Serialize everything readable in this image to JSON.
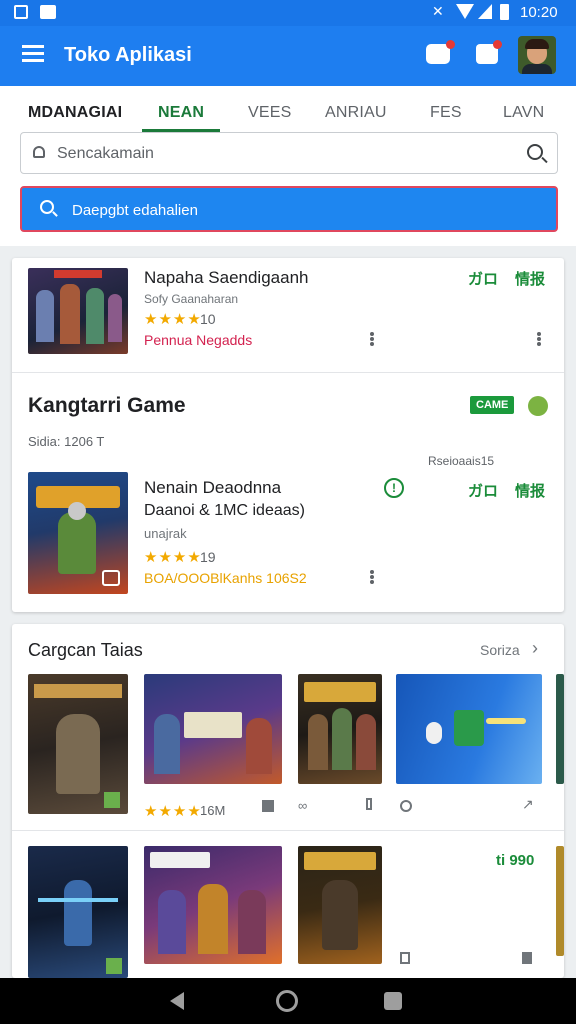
{
  "status": {
    "time": "10:20"
  },
  "appbar": {
    "title": "Toko Aplikasi"
  },
  "tabs": [
    "MDANAGIAI",
    "NEAN",
    "VEES",
    "ANRIAU",
    "FES",
    "LAVN"
  ],
  "search": {
    "placeholder": "Sencakamain",
    "button_label": "Daepgbt edahalien"
  },
  "featured": {
    "title": "Napaha Saendigaanh",
    "subtitle": "Sofy Gaanaharan",
    "rating": "10",
    "tag": "Pennua Negadds",
    "action1": "ガロ",
    "action2": "情报"
  },
  "section": {
    "title": "Kangtarri Game",
    "badge": "CAME",
    "meta": "Sidia: 1206 T",
    "note": "Rseioaais15"
  },
  "item": {
    "title": "Nenain Deaodnna",
    "subtitle": "Daanoi & 1MC ideaas)",
    "developer": "unajrak",
    "rating": "19",
    "downloads": "BOA/OOOBlKanhs 106S2",
    "action1": "ガロ",
    "action2": "情报"
  },
  "carousel": {
    "title": "Cargcan Taias",
    "more": "Soriza",
    "row1_rating": "16M",
    "row2_action": "ti 990"
  },
  "colors": {
    "primary": "#1e7ef0",
    "accent_green": "#1b8c3a",
    "star": "#f2a900"
  }
}
